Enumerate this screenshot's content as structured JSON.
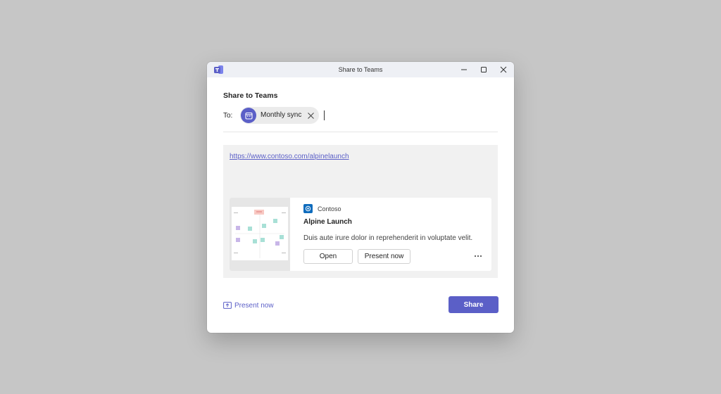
{
  "window": {
    "title": "Share to Teams"
  },
  "dialog": {
    "heading": "Share to Teams",
    "to_label": "To:",
    "recipient": {
      "label": "Monthly sync",
      "icon": "calendar-icon"
    }
  },
  "preview": {
    "url": "https://www.contoso.com/alpinelaunch",
    "card": {
      "provider": "Contoso",
      "title": "Alpine Launch",
      "description": "Duis aute irure dolor in reprehenderit in voluptate velit.",
      "open_label": "Open",
      "present_label": "Present now",
      "more_label": "···"
    }
  },
  "footer": {
    "present_now_label": "Present now",
    "share_label": "Share"
  },
  "colors": {
    "accent": "#5b5fc7",
    "provider": "#0f6cbd",
    "backdrop": "#c6c6c6"
  }
}
